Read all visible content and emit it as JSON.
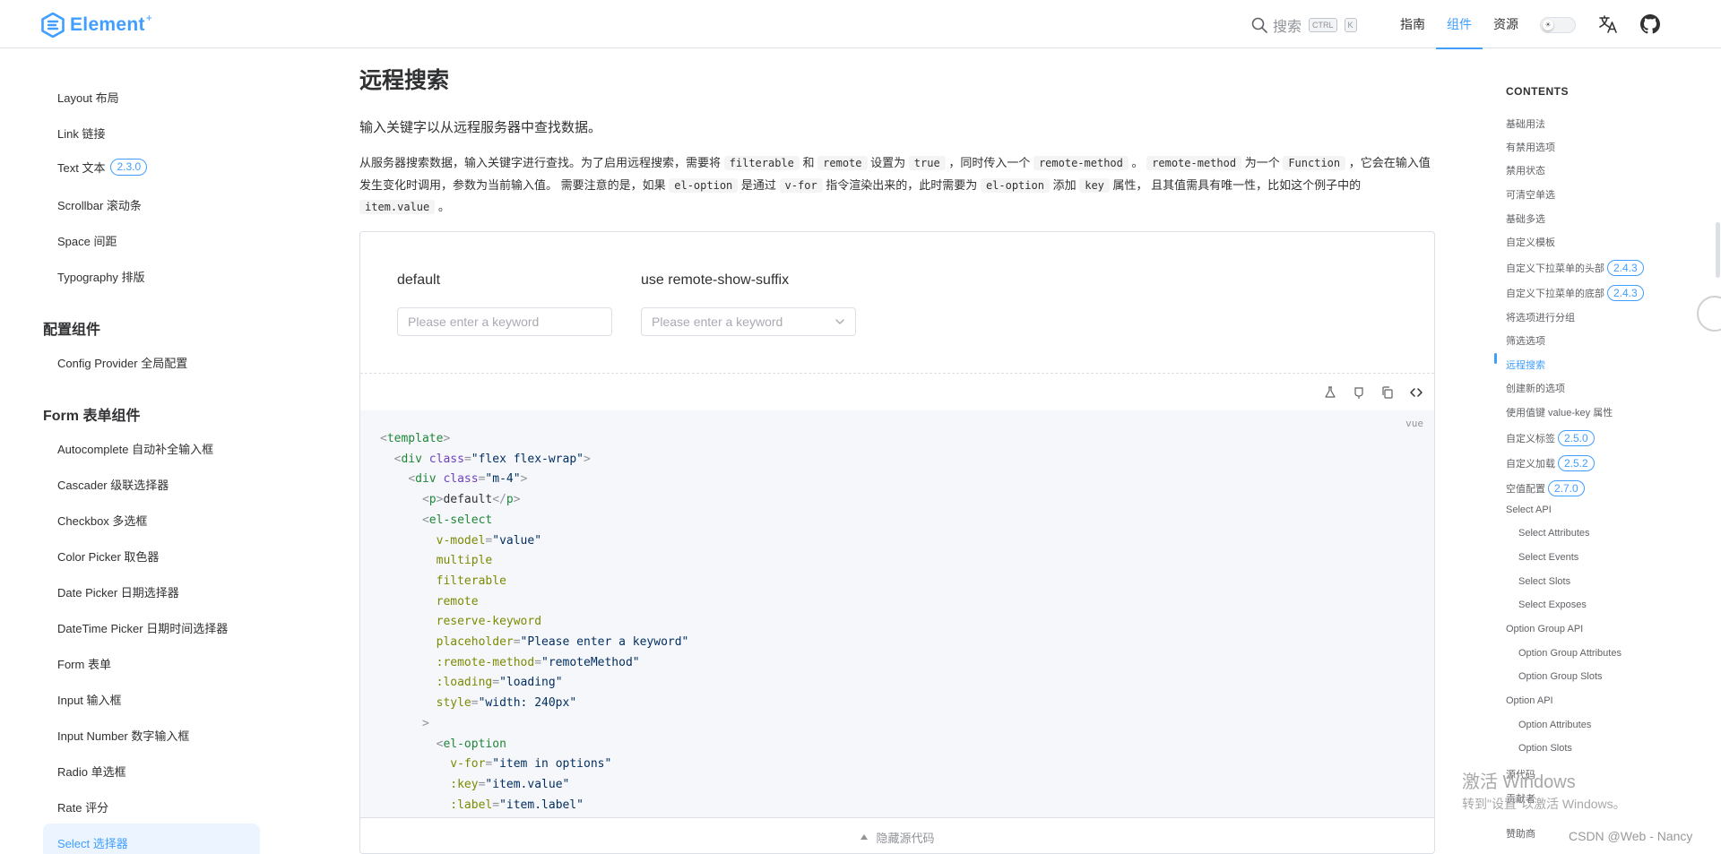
{
  "colors": {
    "accent": "#409eff",
    "text": "#303133",
    "muted": "#909399"
  },
  "topnav": {
    "logo_text": "Element",
    "logo_plus": "+",
    "search_label": "搜索",
    "kbd_ctrl": "CTRL",
    "kbd_k": "K",
    "links": [
      {
        "label": "指南"
      },
      {
        "label": "组件",
        "active": true
      },
      {
        "label": "资源"
      }
    ]
  },
  "sidebar": {
    "items_top": [
      {
        "label": "Layout 布局"
      },
      {
        "label": "Link 链接"
      },
      {
        "label": "Text 文本",
        "badge": "2.3.0"
      },
      {
        "label": "Scrollbar 滚动条"
      },
      {
        "label": "Space 间距"
      },
      {
        "label": "Typography 排版"
      }
    ],
    "group_config": "配置组件",
    "items_config": [
      {
        "label": "Config Provider 全局配置"
      }
    ],
    "group_form": "Form 表单组件",
    "items_form": [
      {
        "label": "Autocomplete 自动补全输入框"
      },
      {
        "label": "Cascader 级联选择器"
      },
      {
        "label": "Checkbox 多选框"
      },
      {
        "label": "Color Picker 取色器"
      },
      {
        "label": "Date Picker 日期选择器"
      },
      {
        "label": "DateTime Picker 日期时间选择器"
      },
      {
        "label": "Form 表单"
      },
      {
        "label": "Input 输入框"
      },
      {
        "label": "Input Number 数字输入框"
      },
      {
        "label": "Radio 单选框"
      },
      {
        "label": "Rate 评分"
      },
      {
        "label": "Select 选择器",
        "active": true
      }
    ]
  },
  "main": {
    "title": "远程搜索",
    "lead": "输入关键字以从远程服务器中查找数据。",
    "desc": {
      "p1": "从服务器搜索数据，输入关键字进行查找。为了启用远程搜索，需要将",
      "c1": "filterable",
      "p2": "和",
      "c2": "remote",
      "p3": "设置为",
      "c3": "true",
      "p4": "，同时传入一个",
      "c4": "remote-method",
      "p5": "。",
      "c5": "remote-method",
      "p6": "为一个",
      "c6": "Function",
      "p7": "，它会在输入值发生变化时调用，参数为当前输入值。 需要注意的是，如果",
      "c7": "el-option",
      "p8": "是通过",
      "c8": "v-for",
      "p9": "指令渲染出来的，此时需要为",
      "c9": "el-option",
      "p10": "添加",
      "c10": "key",
      "p11": "属性， 且其值需具有唯一性，比如这个例子中的",
      "c11": "item.value",
      "p12": "。"
    },
    "demo": {
      "label_default": "default",
      "label_suffix": "use remote-show-suffix",
      "placeholder1": "Please enter a keyword",
      "placeholder2": "Please enter a keyword",
      "code_lang": "vue",
      "hide_code": "隐藏源代码",
      "code": [
        {
          "indent": "",
          "parts": [
            [
              "t-br",
              "<"
            ],
            [
              "t-tag",
              "template"
            ],
            [
              "t-br",
              ">"
            ]
          ]
        },
        {
          "indent": "  ",
          "parts": [
            [
              "t-br",
              "<"
            ],
            [
              "t-tag",
              "div "
            ],
            [
              "t-attr",
              "class"
            ],
            [
              "t-br",
              "="
            ],
            [
              "t-str",
              "\"flex flex-wrap\""
            ],
            [
              "t-br",
              ">"
            ]
          ]
        },
        {
          "indent": "    ",
          "parts": [
            [
              "t-br",
              "<"
            ],
            [
              "t-tag",
              "div "
            ],
            [
              "t-attr",
              "class"
            ],
            [
              "t-br",
              "="
            ],
            [
              "t-str",
              "\"m-4\""
            ],
            [
              "t-br",
              ">"
            ]
          ]
        },
        {
          "indent": "      ",
          "parts": [
            [
              "t-br",
              "<"
            ],
            [
              "t-tag",
              "p"
            ],
            [
              "t-br",
              ">"
            ],
            [
              "",
              "default"
            ],
            [
              "t-br",
              "</"
            ],
            [
              "t-tag",
              "p"
            ],
            [
              "t-br",
              ">"
            ]
          ]
        },
        {
          "indent": "      ",
          "parts": [
            [
              "t-br",
              "<"
            ],
            [
              "t-tag",
              "el-select"
            ]
          ]
        },
        {
          "indent": "        ",
          "parts": [
            [
              "t-attr2",
              "v-model"
            ],
            [
              "t-br",
              "="
            ],
            [
              "t-str",
              "\"value\""
            ]
          ]
        },
        {
          "indent": "        ",
          "parts": [
            [
              "t-attr2",
              "multiple"
            ]
          ]
        },
        {
          "indent": "        ",
          "parts": [
            [
              "t-attr2",
              "filterable"
            ]
          ]
        },
        {
          "indent": "        ",
          "parts": [
            [
              "t-attr2",
              "remote"
            ]
          ]
        },
        {
          "indent": "        ",
          "parts": [
            [
              "t-attr2",
              "reserve-keyword"
            ]
          ]
        },
        {
          "indent": "        ",
          "parts": [
            [
              "t-attr2",
              "placeholder"
            ],
            [
              "t-br",
              "="
            ],
            [
              "t-str",
              "\"Please enter a keyword\""
            ]
          ]
        },
        {
          "indent": "        ",
          "parts": [
            [
              "t-attr2",
              ":remote-method"
            ],
            [
              "t-br",
              "="
            ],
            [
              "t-str",
              "\"remoteMethod\""
            ]
          ]
        },
        {
          "indent": "        ",
          "parts": [
            [
              "t-attr2",
              ":loading"
            ],
            [
              "t-br",
              "="
            ],
            [
              "t-str",
              "\"loading\""
            ]
          ]
        },
        {
          "indent": "        ",
          "parts": [
            [
              "t-attr2",
              "style"
            ],
            [
              "t-br",
              "="
            ],
            [
              "t-str",
              "\"width: 240px\""
            ]
          ]
        },
        {
          "indent": "      ",
          "parts": [
            [
              "t-br",
              ">"
            ]
          ]
        },
        {
          "indent": "        ",
          "parts": [
            [
              "t-br",
              "<"
            ],
            [
              "t-tag",
              "el-option"
            ]
          ]
        },
        {
          "indent": "          ",
          "parts": [
            [
              "t-attr2",
              "v-for"
            ],
            [
              "t-br",
              "="
            ],
            [
              "t-str",
              "\"item in options\""
            ]
          ]
        },
        {
          "indent": "          ",
          "parts": [
            [
              "t-attr2",
              ":key"
            ],
            [
              "t-br",
              "="
            ],
            [
              "t-str",
              "\"item.value\""
            ]
          ]
        },
        {
          "indent": "          ",
          "parts": [
            [
              "t-attr2",
              ":label"
            ],
            [
              "t-br",
              "="
            ],
            [
              "t-str",
              "\"item.label\""
            ]
          ]
        }
      ]
    }
  },
  "toc": {
    "title": "CONTENTS",
    "items": [
      {
        "label": "基础用法"
      },
      {
        "label": "有禁用选项"
      },
      {
        "label": "禁用状态"
      },
      {
        "label": "可清空单选"
      },
      {
        "label": "基础多选"
      },
      {
        "label": "自定义模板"
      },
      {
        "label": "自定义下拉菜单的头部",
        "badge": "2.4.3"
      },
      {
        "label": "自定义下拉菜单的底部",
        "badge": "2.4.3"
      },
      {
        "label": "将选项进行分组"
      },
      {
        "label": "筛选选项"
      },
      {
        "label": "远程搜索",
        "active": true
      },
      {
        "label": "创建新的选项"
      },
      {
        "label": "使用值键 value-key 属性"
      },
      {
        "label": "自定义标签",
        "badge": "2.5.0"
      },
      {
        "label": "自定义加载",
        "badge": "2.5.2"
      },
      {
        "label": "空值配置",
        "badge": "2.7.0"
      },
      {
        "label": "Select API"
      },
      {
        "label": "Select Attributes",
        "sub": true
      },
      {
        "label": "Select Events",
        "sub": true
      },
      {
        "label": "Select Slots",
        "sub": true
      },
      {
        "label": "Select Exposes",
        "sub": true
      },
      {
        "label": "Option Group API"
      },
      {
        "label": "Option Group Attributes",
        "sub": true
      },
      {
        "label": "Option Group Slots",
        "sub": true
      },
      {
        "label": "Option API"
      },
      {
        "label": "Option Attributes",
        "sub": true
      },
      {
        "label": "Option Slots",
        "sub": true
      },
      {
        "label": "源代码"
      },
      {
        "label": "贡献者"
      },
      {
        "label": "赞助商"
      }
    ]
  },
  "overlay": {
    "activate_title": "激活 Windows",
    "activate_sub": "转到\"设置\"以激活 Windows。",
    "csdn": "CSDN @Web - Nancy"
  }
}
